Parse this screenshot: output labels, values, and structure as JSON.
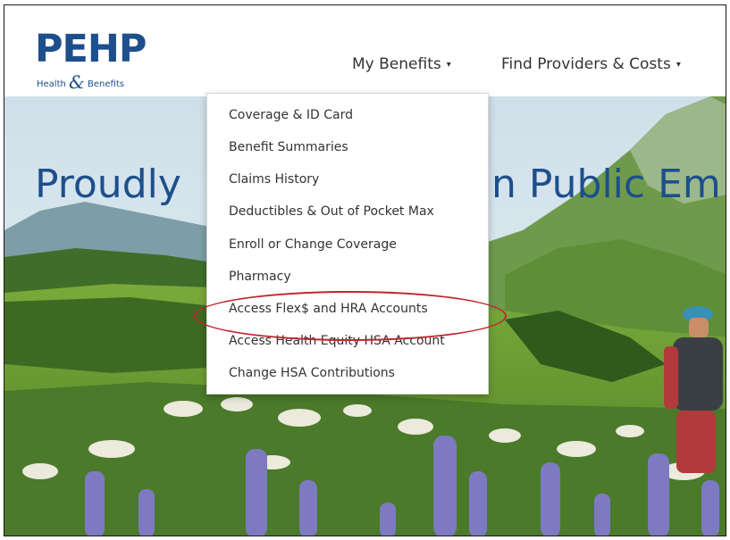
{
  "logo": {
    "main": "PEHP",
    "sub_left": "Health",
    "sub_amp": "&",
    "sub_right": "Benefits"
  },
  "nav": {
    "my_benefits": "My Benefits",
    "find_providers": "Find Providers & Costs",
    "caret": "▾"
  },
  "hero": {
    "headline": "Proudly",
    "headline_tail": "n Public Em"
  },
  "dropdown": {
    "items": [
      "Coverage & ID Card",
      "Benefit Summaries",
      "Claims History",
      "Deductibles & Out of Pocket Max",
      "Enroll or Change Coverage",
      "Pharmacy",
      "Access Flex$ and HRA Accounts",
      "Access Health Equity HSA Account",
      "Change HSA Contributions"
    ]
  },
  "colors": {
    "brand": "#1d4f8c",
    "highlight": "#c0262d",
    "nav_text": "#333333"
  }
}
